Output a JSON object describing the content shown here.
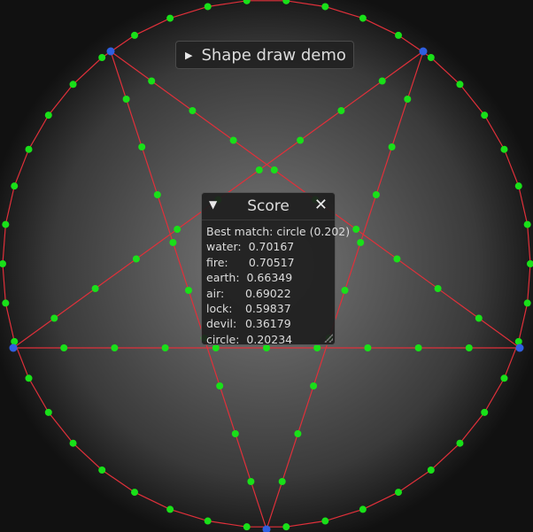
{
  "demo_button": {
    "icon": "play-triangle-icon",
    "label": "Shape draw demo"
  },
  "score_window": {
    "title": "Score",
    "collapse_icon": "collapse-triangle-icon",
    "close_icon": "close-icon",
    "best_match": "Best match: circle (0.202)",
    "scores": [
      {
        "label": "water:",
        "value": "0.70167"
      },
      {
        "label": "fire:",
        "value": "0.70517"
      },
      {
        "label": "earth:",
        "value": "0.66349"
      },
      {
        "label": "air:",
        "value": "0.69022"
      },
      {
        "label": "lock:",
        "value": "0.59837"
      },
      {
        "label": "devil:",
        "value": "0.36179"
      },
      {
        "label": "circle:",
        "value": "0.20234"
      }
    ]
  },
  "colors": {
    "stroke": "#e0303a",
    "sample_point": "#19e019",
    "corner_point": "#2f5fe0",
    "background_dark": "#2a2a2a"
  }
}
